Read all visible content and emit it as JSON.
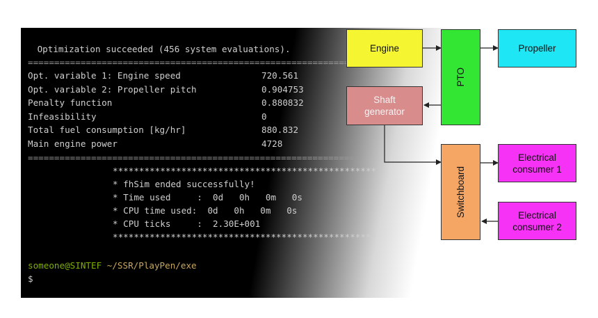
{
  "terminal": {
    "header": " Optimization succeeded (456 system evaluations).",
    "rule": "==============================================================",
    "rows": [
      {
        "label": "Opt. variable 1: Engine speed",
        "value": "720.561"
      },
      {
        "label": "Opt. variable 2: Propeller pitch",
        "value": "0.904753"
      },
      {
        "label": "Penalty function",
        "value": "0.880832"
      },
      {
        "label": "Infeasibility",
        "value": "0"
      },
      {
        "label": "Total fuel consumption [kg/hr]",
        "value": "880.832"
      },
      {
        "label": "Main engine power",
        "value": "4728"
      }
    ],
    "stars": "**************************************************",
    "sim_lines": [
      "* fhSim ended successfully!",
      "* Time used     :  0d   0h   0m   0s",
      "* CPU time used:  0d   0h   0m   0s",
      "* CPU ticks     :  2.30E+001"
    ],
    "prompt_user": "someone@SINTEF",
    "prompt_path": " ~/SSR/PlayPen/exe",
    "prompt_symbol": "$"
  },
  "diagram": {
    "engine": "Engine",
    "pto": "PTO",
    "propeller": "Propeller",
    "shaft_generator": "Shaft generator",
    "switchboard": "Switchboard",
    "consumer1": "Electrical consumer 1",
    "consumer2": "Electrical consumer 2"
  },
  "colors": {
    "engine": "#f5f532",
    "pto": "#33e633",
    "propeller": "#1ee6f5",
    "shaft_generator": "#d98c8c",
    "switchboard": "#f5a564",
    "consumer": "#f532f5"
  }
}
